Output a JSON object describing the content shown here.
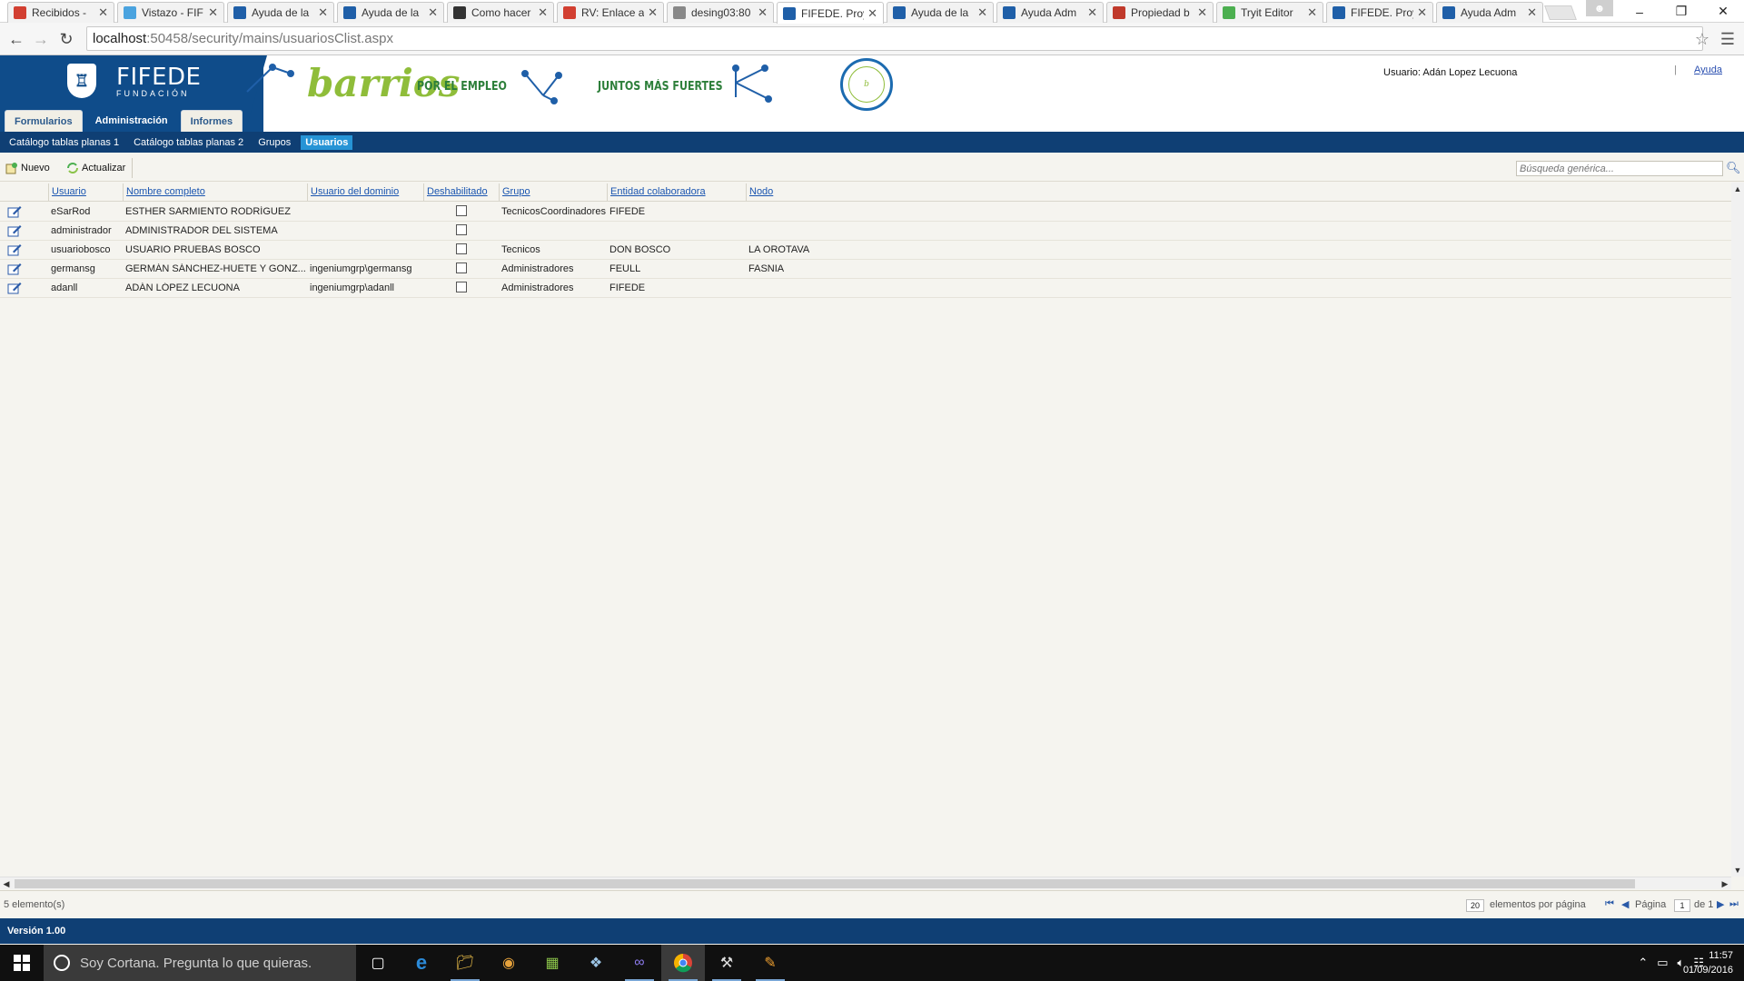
{
  "browser": {
    "tabs": [
      {
        "label": "Recibidos - ",
        "color": "#d23f31"
      },
      {
        "label": "Vistazo - FIF",
        "color": "#4aa3df"
      },
      {
        "label": "Ayuda de la",
        "color": "#1f5fa8"
      },
      {
        "label": "Ayuda de la",
        "color": "#1f5fa8"
      },
      {
        "label": "Como hacer",
        "color": "#333333"
      },
      {
        "label": "RV: Enlace a",
        "color": "#d23f31"
      },
      {
        "label": "desing03:80",
        "color": "#888888"
      },
      {
        "label": "FIFEDE. Proy",
        "color": "#1f5fa8"
      },
      {
        "label": "Ayuda de la",
        "color": "#1f5fa8"
      },
      {
        "label": "Ayuda Adm",
        "color": "#1f5fa8"
      },
      {
        "label": "Propiedad b",
        "color": "#c0392b"
      },
      {
        "label": "Tryit Editor",
        "color": "#4caf50"
      },
      {
        "label": "FIFEDE. Proy",
        "color": "#1f5fa8"
      },
      {
        "label": "Ayuda Adm",
        "color": "#1f5fa8"
      }
    ],
    "active_tab_index": 7,
    "url_host": "localhost",
    "url_rest": ":50458/security/mains/usuariosClist.aspx",
    "window_controls": {
      "minimize": "–",
      "restore": "❐",
      "close": "✕"
    }
  },
  "header": {
    "logo_name": "FIFEDE",
    "logo_sub": "FUNDACIÓN",
    "barrios": "barrios",
    "slogan1": "POR EL EMPLEO",
    "slogan2": "JUNTOS MÁS FUERTES",
    "user_label": "Usuario: Adán Lopez Lecuona",
    "separator": "|",
    "help_link": "Ayuda",
    "main_tabs": [
      {
        "label": "Formularios",
        "active": false
      },
      {
        "label": "Administración",
        "active": true
      },
      {
        "label": "Informes",
        "active": false
      }
    ]
  },
  "subnav": {
    "items": [
      {
        "label": "Catálogo tablas planas 1",
        "active": false
      },
      {
        "label": "Catálogo tablas planas 2",
        "active": false
      },
      {
        "label": "Grupos",
        "active": false
      },
      {
        "label": "Usuarios",
        "active": true
      }
    ]
  },
  "toolbar": {
    "new_label": "Nuevo",
    "refresh_label": "Actualizar",
    "search_placeholder": "Búsqueda genérica..."
  },
  "grid": {
    "columns": [
      "Usuario",
      "Nombre completo",
      "Usuario del dominio",
      "Deshabilitado",
      "Grupo",
      "Entidad colaboradora",
      "Nodo"
    ],
    "rows": [
      {
        "usuario": "eSarRod",
        "nombre": "ESTHER SARMIENTO RODRÍGUEZ",
        "dominio": "",
        "deshabilitado": false,
        "grupo": "TecnicosCoordinadores",
        "entidad": "FIFEDE",
        "nodo": ""
      },
      {
        "usuario": "administrador",
        "nombre": "ADMINISTRADOR DEL SISTEMA",
        "dominio": "",
        "deshabilitado": false,
        "grupo": "",
        "entidad": "",
        "nodo": ""
      },
      {
        "usuario": "usuariobosco",
        "nombre": "USUARIO PRUEBAS BOSCO",
        "dominio": "",
        "deshabilitado": false,
        "grupo": "Tecnicos",
        "entidad": "DON BOSCO",
        "nodo": "LA OROTAVA"
      },
      {
        "usuario": "germansg",
        "nombre": "GERMÁN SÁNCHEZ-HUETE Y GONZ...",
        "dominio": "ingeniumgrp\\germansg",
        "deshabilitado": false,
        "grupo": "Administradores",
        "entidad": "FEULL",
        "nodo": "FASNIA"
      },
      {
        "usuario": "adanll",
        "nombre": "ADÁN LÓPEZ LECUONA",
        "dominio": "ingeniumgrp\\adanll",
        "deshabilitado": false,
        "grupo": "Administradores",
        "entidad": "FIFEDE",
        "nodo": ""
      }
    ]
  },
  "pager": {
    "count_text": "5 elemento(s)",
    "page_size": "20",
    "page_size_label": "elementos por página",
    "page_label": "Página",
    "page_number": "1",
    "of_label": "de 1"
  },
  "footer": {
    "version": "Versión 1.00"
  },
  "taskbar": {
    "cortana_placeholder": "Soy Cortana. Pregunta lo que quieras.",
    "time": "11:57",
    "date": "01/09/2016"
  },
  "colors": {
    "brand_blue": "#0f4c8a",
    "subnav_blue": "#0f3f74",
    "active_subnav": "#2694d6",
    "brand_green": "#8fbd3a"
  }
}
